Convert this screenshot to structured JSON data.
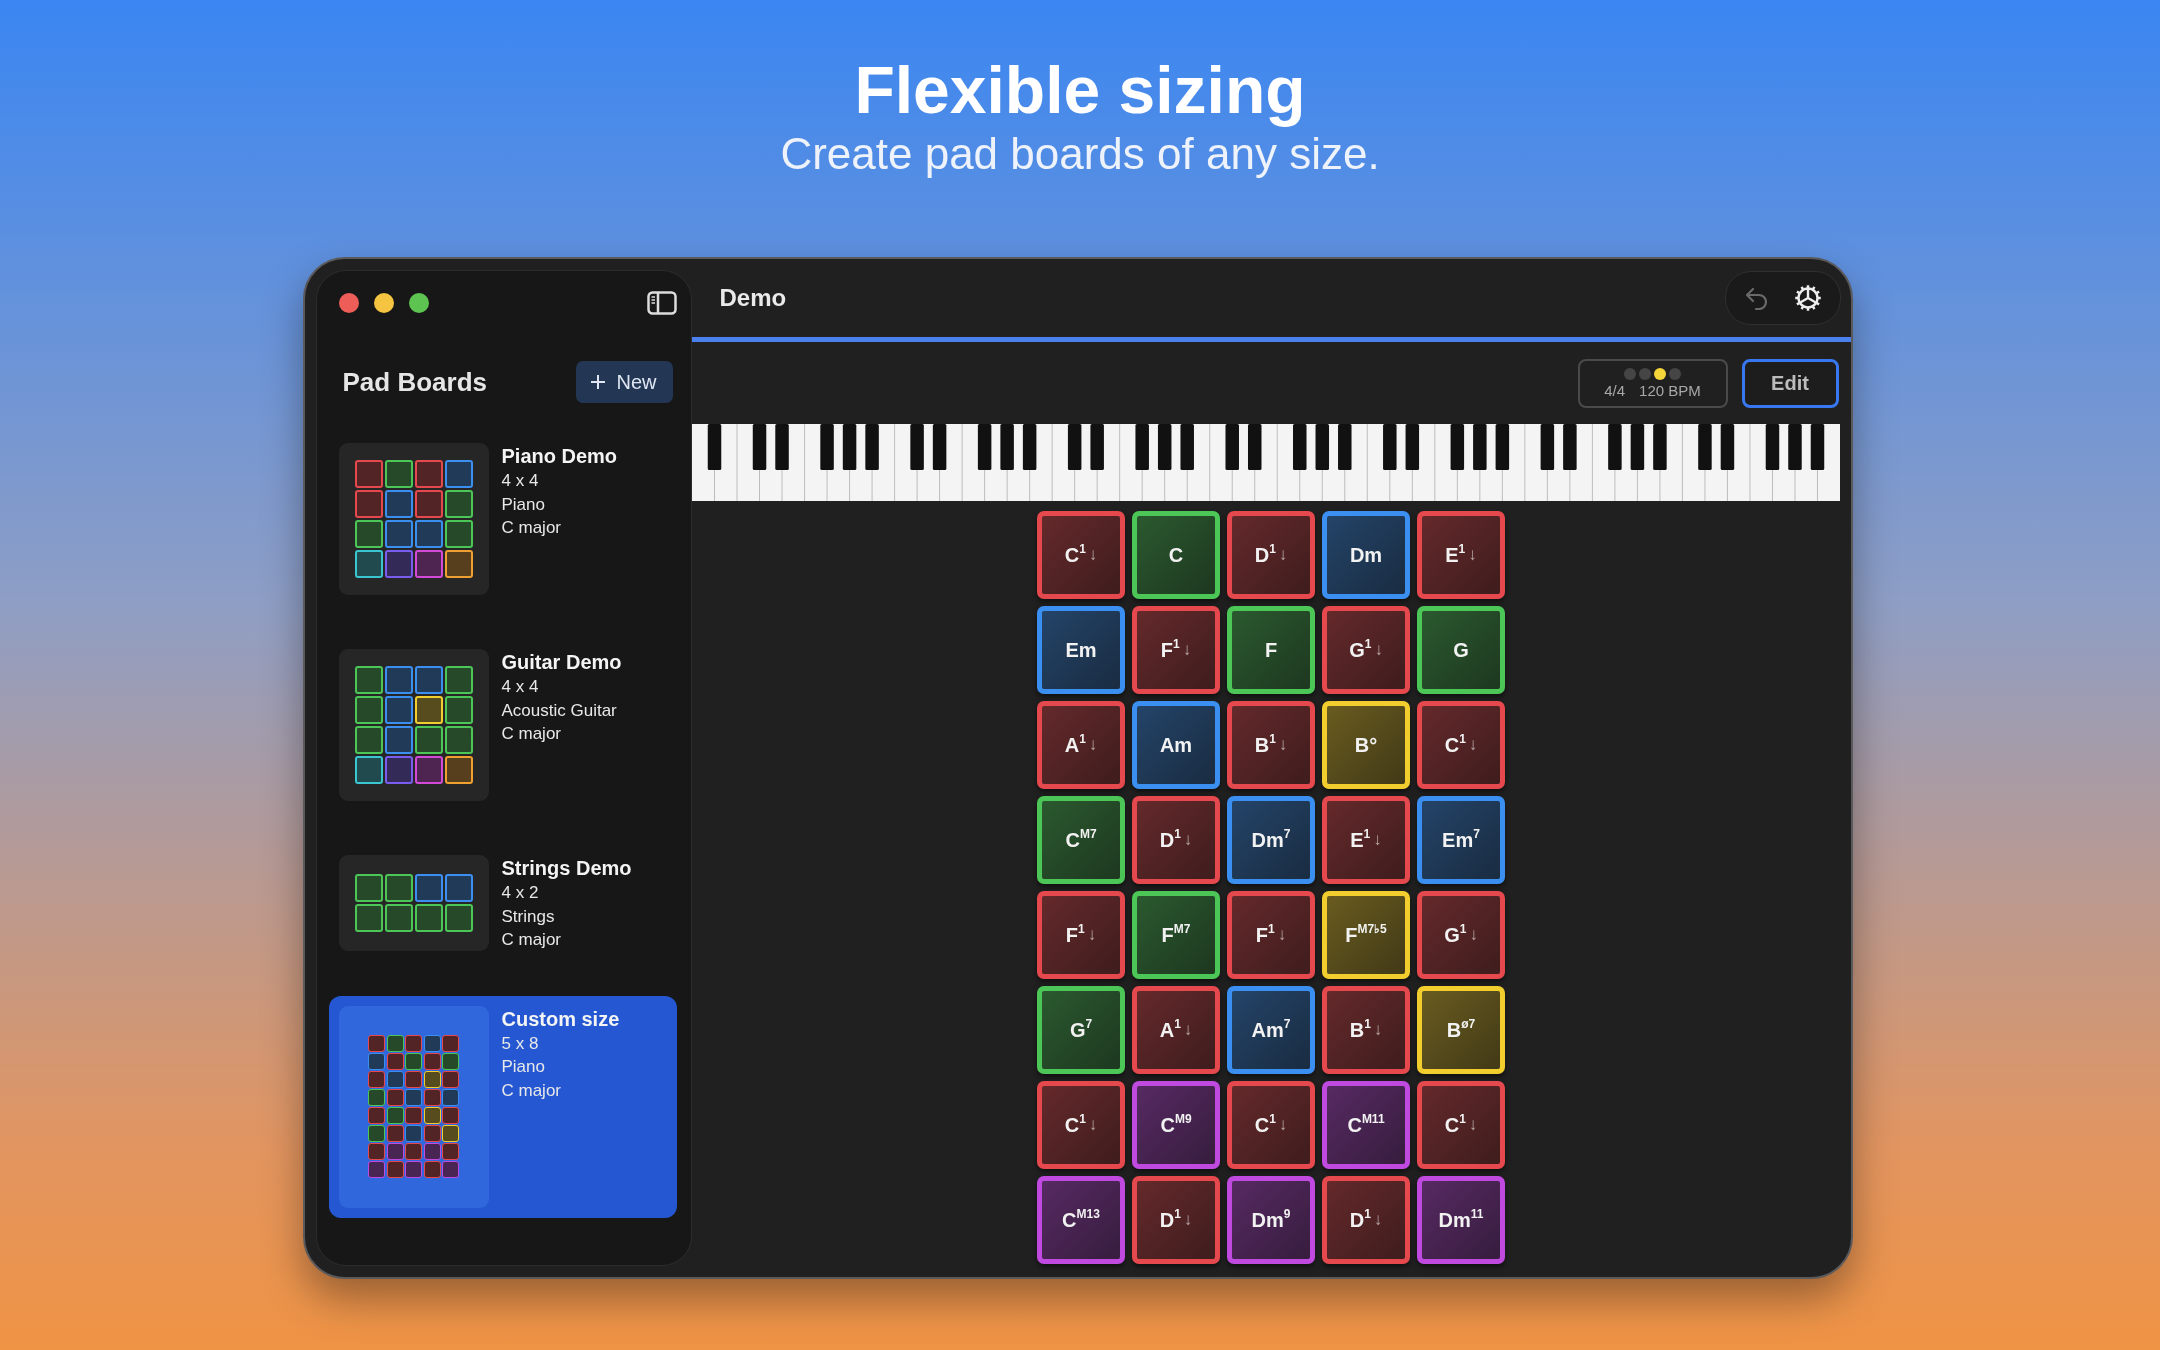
{
  "header": {
    "title": "Flexible sizing",
    "subtitle": "Create pad boards of any size."
  },
  "window": {
    "title": "Demo",
    "undo_disabled": true
  },
  "sidebar": {
    "title": "Pad Boards",
    "new_button": "New",
    "boards": [
      {
        "title": "Piano Demo",
        "size": "4 x 4",
        "instrument": "Piano",
        "key": "C major",
        "selected": false,
        "thumbnail": [
          [
            {
              "color": "#e5484d"
            },
            {
              "color": "#4cc757"
            },
            {
              "color": "#e5484d"
            },
            {
              "color": "#3a8ff0"
            }
          ],
          [
            {
              "color": "#e5484d"
            },
            {
              "color": "#3a8ff0"
            },
            {
              "color": "#e5484d"
            },
            {
              "color": "#4cc757"
            }
          ],
          [
            {
              "color": "#4cc757"
            },
            {
              "color": "#3a8ff0"
            },
            {
              "color": "#3a8ff0"
            },
            {
              "color": "#4cc757"
            }
          ],
          [
            {
              "color": "#3ac6d0"
            },
            {
              "color": "#7b5cf0"
            },
            {
              "color": "#d44ad8"
            },
            {
              "color": "#f0a030"
            }
          ]
        ]
      },
      {
        "title": "Guitar Demo",
        "size": "4 x 4",
        "instrument": "Acoustic Guitar",
        "key": "C major",
        "selected": false,
        "thumbnail": [
          [
            {
              "color": "#4cc757"
            },
            {
              "color": "#3a8ff0"
            },
            {
              "color": "#3a8ff0"
            },
            {
              "color": "#4cc757"
            }
          ],
          [
            {
              "color": "#4cc757"
            },
            {
              "color": "#3a8ff0"
            },
            {
              "color": "#f2cd2e"
            },
            {
              "color": "#4cc757"
            }
          ],
          [
            {
              "color": "#4cc757"
            },
            {
              "color": "#3a8ff0"
            },
            {
              "color": "#4cc757"
            },
            {
              "color": "#4cc757"
            }
          ],
          [
            {
              "color": "#3ac6d0"
            },
            {
              "color": "#7b5cf0"
            },
            {
              "color": "#d44ad8"
            },
            {
              "color": "#f0a030"
            }
          ]
        ]
      },
      {
        "title": "Strings Demo",
        "size": "4 x 2",
        "instrument": "Strings",
        "key": "C major",
        "selected": false,
        "thumbnail": [
          [
            {
              "color": "#4cc757"
            },
            {
              "color": "#4cc757"
            },
            {
              "color": "#3a8ff0"
            },
            {
              "color": "#3a8ff0"
            }
          ],
          [
            {
              "color": "#4cc757"
            },
            {
              "color": "#4cc757"
            },
            {
              "color": "#4cc757"
            },
            {
              "color": "#4cc757"
            }
          ]
        ]
      },
      {
        "title": "Custom size",
        "size": "5 x 8",
        "instrument": "Piano",
        "key": "C major",
        "selected": true
      }
    ]
  },
  "metronome": {
    "beats": [
      {
        "on": false
      },
      {
        "on": false
      },
      {
        "on": true
      },
      {
        "on": false
      }
    ],
    "meter": "4/4",
    "tempo": "120 BPM"
  },
  "edit_button": "Edit",
  "pads": [
    [
      {
        "label": "C$^{1}$",
        "arrow": "↓",
        "color": "#e5484d"
      },
      {
        "label": "C",
        "color": "#4cc757"
      },
      {
        "label": "D$^{1}$",
        "arrow": "↓",
        "color": "#e5484d"
      },
      {
        "label": "Dm",
        "color": "#3a8ff0"
      },
      {
        "label": "E$^{1}$",
        "arrow": "↓",
        "color": "#e5484d"
      }
    ],
    [
      {
        "label": "Em",
        "color": "#3a8ff0"
      },
      {
        "label": "F$^{1}$",
        "arrow": "↓",
        "color": "#e5484d"
      },
      {
        "label": "F",
        "color": "#4cc757"
      },
      {
        "label": "G$^{1}$",
        "arrow": "↓",
        "color": "#e5484d"
      },
      {
        "label": "G",
        "color": "#4cc757"
      }
    ],
    [
      {
        "label": "A$^{1}$",
        "arrow": "↓",
        "color": "#e5484d"
      },
      {
        "label": "Am",
        "color": "#3a8ff0"
      },
      {
        "label": "B$^{1}$",
        "arrow": "↓",
        "color": "#e5484d"
      },
      {
        "label": "B°",
        "color": "#f2cd2e"
      },
      {
        "label": "C$^{1}$",
        "arrow": "↓",
        "color": "#e5484d"
      }
    ],
    [
      {
        "label": "C$^{M7}$",
        "color": "#4cc757"
      },
      {
        "label": "D$^{1}$",
        "arrow": "↓",
        "color": "#e5484d"
      },
      {
        "label": "Dm$^{7}$",
        "color": "#3a8ff0"
      },
      {
        "label": "E$^{1}$",
        "arrow": "↓",
        "color": "#e5484d"
      },
      {
        "label": "Em$^{7}$",
        "color": "#3a8ff0"
      }
    ],
    [
      {
        "label": "F$^{1}$",
        "arrow": "↓",
        "color": "#e5484d"
      },
      {
        "label": "F$^{M7}$",
        "color": "#4cc757"
      },
      {
        "label": "F$^{1}$",
        "arrow": "↓",
        "color": "#e5484d"
      },
      {
        "label": "F$^{M7♭5}$",
        "color": "#f2cd2e"
      },
      {
        "label": "G$^{1}$",
        "arrow": "↓",
        "color": "#e5484d"
      }
    ],
    [
      {
        "label": "G$^{7}$",
        "color": "#4cc757"
      },
      {
        "label": "A$^{1}$",
        "arrow": "↓",
        "color": "#e5484d"
      },
      {
        "label": "Am$^{7}$",
        "color": "#3a8ff0"
      },
      {
        "label": "B$^{1}$",
        "arrow": "↓",
        "color": "#e5484d"
      },
      {
        "label": "B$^{ø7}$",
        "color": "#f2cd2e"
      }
    ],
    [
      {
        "label": "C$^{1}$",
        "arrow": "↓",
        "color": "#e5484d"
      },
      {
        "label": "C$^{M9}$",
        "color": "#c04ae0"
      },
      {
        "label": "C$^{1}$",
        "arrow": "↓",
        "color": "#e5484d"
      },
      {
        "label": "C$^{M11}$",
        "color": "#c04ae0"
      },
      {
        "label": "C$^{1}$",
        "arrow": "↓",
        "color": "#e5484d"
      }
    ],
    [
      {
        "label": "C$^{M13}$",
        "color": "#c04ae0"
      },
      {
        "label": "D$^{1}$",
        "arrow": "↓",
        "color": "#e5484d"
      },
      {
        "label": "Dm$^{9}$",
        "color": "#c04ae0"
      },
      {
        "label": "D$^{1}$",
        "arrow": "↓",
        "color": "#e5484d"
      },
      {
        "label": "Dm$^{11}$",
        "color": "#c04ae0"
      }
    ]
  ]
}
